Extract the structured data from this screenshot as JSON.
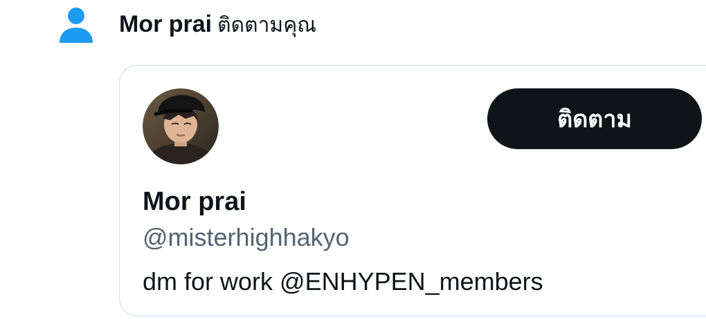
{
  "notification": {
    "icon": "person-icon",
    "icon_color": "#1d9bf0",
    "user_name": "Mor prai",
    "action_text": "ติดตามคุณ"
  },
  "user_card": {
    "avatar": "profile-photo",
    "follow_label": "ติดตาม",
    "display_name": "Mor prai",
    "handle": "@misterhighhakyo",
    "bio": "dm for work @ENHYPEN_members"
  },
  "colors": {
    "text_primary": "#0f1419",
    "text_secondary": "#536471",
    "border": "#cfd9de",
    "button_bg": "#0f1419",
    "button_text": "#ffffff",
    "accent": "#1d9bf0"
  }
}
